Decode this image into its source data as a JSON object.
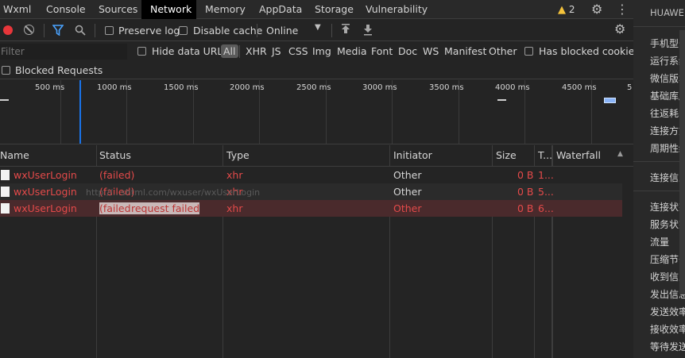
{
  "tabs": [
    "Wxml",
    "Console",
    "Sources",
    "Network",
    "Memory",
    "AppData",
    "Storage",
    "Vulnerability"
  ],
  "active_tab": "Network",
  "warnings": {
    "count": "2"
  },
  "toolbar": {
    "preserve_log": "Preserve log",
    "disable_cache": "Disable cache",
    "throttle": "Online"
  },
  "filter": {
    "placeholder": "Filter",
    "hide_data_urls": "Hide data URLs",
    "types": [
      "All",
      "XHR",
      "JS",
      "CSS",
      "Img",
      "Media",
      "Font",
      "Doc",
      "WS",
      "Manifest",
      "Other"
    ],
    "has_blocked_cookies": "Has blocked cookies",
    "blocked_requests": "Blocked Requests"
  },
  "timeline": {
    "ticks": [
      "500 ms",
      "1000 ms",
      "1500 ms",
      "2000 ms",
      "2500 ms",
      "3000 ms",
      "3500 ms",
      "4000 ms",
      "4500 ms",
      "5"
    ]
  },
  "table": {
    "headers": {
      "name": "Name",
      "status": "Status",
      "type": "Type",
      "initiator": "Initiator",
      "size": "Size",
      "time": "T...",
      "waterfall": "Waterfall"
    },
    "rows": [
      {
        "name": "wxUserLogin",
        "status": "(failed)",
        "type": "xhr",
        "initiator": "Other",
        "size": "0 B",
        "time": "1..."
      },
      {
        "name": "wxUserLogin",
        "status": "(failed)",
        "type": "xhr",
        "initiator": "Other",
        "size": "0 B",
        "time": "5..."
      },
      {
        "name": "wxUserLogin",
        "status": "(failed)",
        "tooltip": "request failed",
        "type": "xhr",
        "initiator": "Other",
        "size": "0 B",
        "time": "6..."
      }
    ],
    "hover_url": "http://...shtml.com/wxuser/wxUserLogin"
  },
  "right_panel": {
    "header": "HUAWEI",
    "items_group1": [
      "手机型号",
      "运行系统",
      "微信版本",
      "基础库版",
      "往返耗时",
      "连接方式",
      "周期性缓"
    ],
    "items_group2": [
      "连接信息"
    ],
    "items_group3": [
      "连接状态",
      "服务状态",
      "流量",
      "压缩节省",
      "收到信息",
      "发出信息",
      "发送效率",
      "接收效率",
      "等待发送"
    ]
  },
  "colors": {
    "failed": "#e44a4a",
    "accent_blue": "#1a73e8",
    "record_red": "#e8363a"
  }
}
